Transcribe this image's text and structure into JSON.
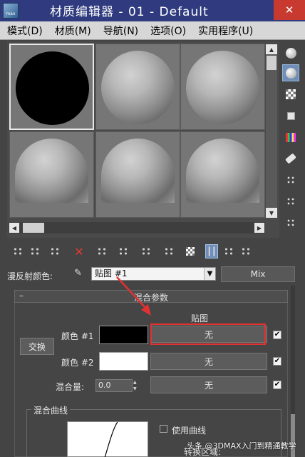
{
  "window": {
    "title": "材质编辑器 - 01 - Default",
    "close_glyph": "✕",
    "app_icon_text": "max"
  },
  "menu": {
    "items": [
      "模式(D)",
      "材质(M)",
      "导航(N)",
      "选项(O)",
      "实用程序(U)"
    ]
  },
  "sample_slots": {
    "count": 6,
    "active_index": 0,
    "first_slot_color": "#000000"
  },
  "side_tools": [
    "sample-type-icon",
    "backlight-icon",
    "background-checker-icon",
    "uv-tiling-icon",
    "video-color-check-icon",
    "make-preview-icon",
    "options-icon",
    "select-by-material-icon",
    "material-id-navigator-icon"
  ],
  "diffuse": {
    "label": "漫反射颜色:",
    "map_name": "贴图 #1",
    "map_type": "Mix"
  },
  "blend_params": {
    "title": "混合参数",
    "map_header": "贴图",
    "swap_label": "交换",
    "color1_label": "颜色 #1",
    "color2_label": "颜色 #2",
    "mix_amount_label": "混合量:",
    "mix_amount_value": "0.0",
    "color1_swatch": "#000000",
    "color2_swatch": "#ffffff",
    "slot_color1": "无",
    "slot_color2": "无",
    "slot_mix": "无",
    "checkbox_mark": "✔",
    "highlight_color": "#e03232"
  },
  "mix_curve": {
    "title": "混合曲线",
    "use_curve_label": "使用曲线",
    "transition_label": "转换区域:"
  },
  "watermark": "头条 @3DMAX入门到精通教学"
}
